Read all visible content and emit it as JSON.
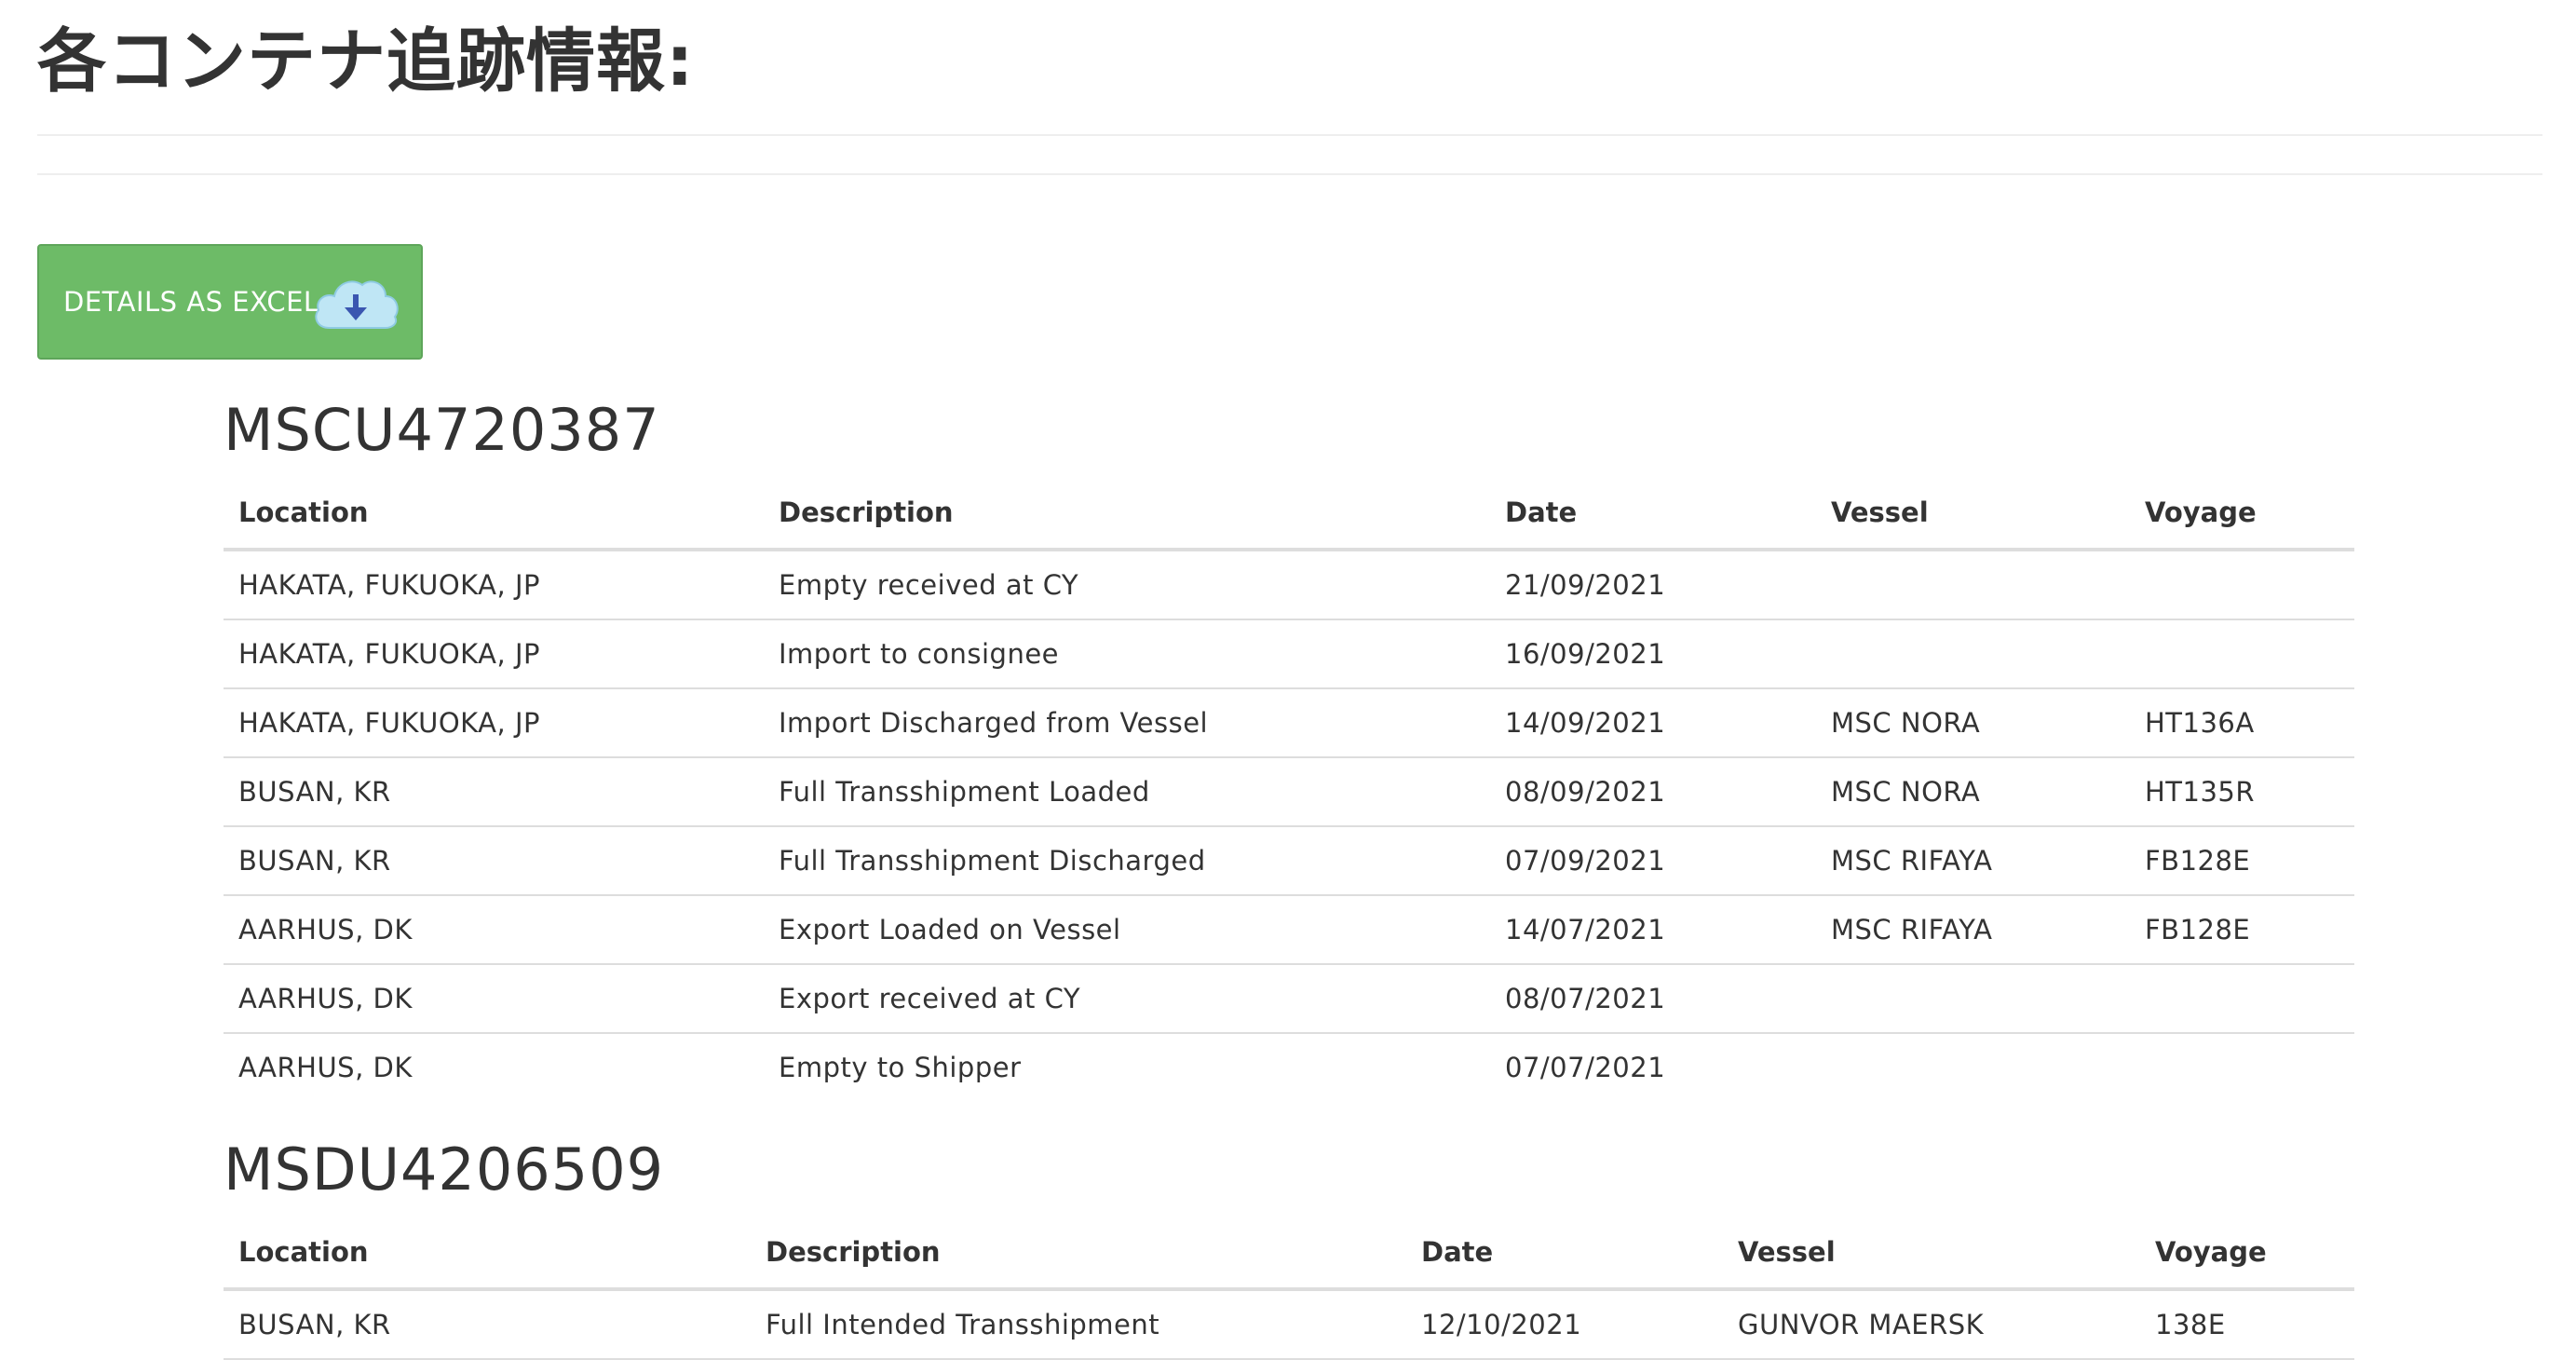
{
  "header": {
    "title": "各コンテナ追跡情報:"
  },
  "toolbar": {
    "excel_label": "DETAILS AS EXCEL",
    "excel_icon": "cloud-download-icon"
  },
  "columns": [
    "Location",
    "Description",
    "Date",
    "Vessel",
    "Voyage"
  ],
  "containers": [
    {
      "id": "MSCU4720387",
      "rows": [
        {
          "location": "HAKATA, FUKUOKA, JP",
          "description": "Empty received at CY",
          "date": "21/09/2021",
          "vessel": "",
          "voyage": ""
        },
        {
          "location": "HAKATA, FUKUOKA, JP",
          "description": "Import to consignee",
          "date": "16/09/2021",
          "vessel": "",
          "voyage": ""
        },
        {
          "location": "HAKATA, FUKUOKA, JP",
          "description": "Import Discharged from Vessel",
          "date": "14/09/2021",
          "vessel": "MSC NORA",
          "voyage": "HT136A"
        },
        {
          "location": "BUSAN, KR",
          "description": "Full Transshipment Loaded",
          "date": "08/09/2021",
          "vessel": "MSC NORA",
          "voyage": "HT135R"
        },
        {
          "location": "BUSAN, KR",
          "description": "Full Transshipment Discharged",
          "date": "07/09/2021",
          "vessel": "MSC RIFAYA",
          "voyage": "FB128E"
        },
        {
          "location": "AARHUS, DK",
          "description": "Export Loaded on Vessel",
          "date": "14/07/2021",
          "vessel": "MSC RIFAYA",
          "voyage": "FB128E"
        },
        {
          "location": "AARHUS, DK",
          "description": "Export received at CY",
          "date": "08/07/2021",
          "vessel": "",
          "voyage": ""
        },
        {
          "location": "AARHUS, DK",
          "description": "Empty to Shipper",
          "date": "07/07/2021",
          "vessel": "",
          "voyage": ""
        }
      ]
    },
    {
      "id": "MSDU4206509",
      "rows": [
        {
          "location": "BUSAN, KR",
          "description": "Full Intended Transshipment",
          "date": "12/10/2021",
          "vessel": "GUNVOR MAERSK",
          "voyage": "138E"
        }
      ]
    }
  ],
  "colors": {
    "button_green": "#6dbb67",
    "text": "#333333",
    "divider": "#dddddd",
    "icon_cloud": "#bfe6f5",
    "icon_arrow": "#3a56b0"
  }
}
